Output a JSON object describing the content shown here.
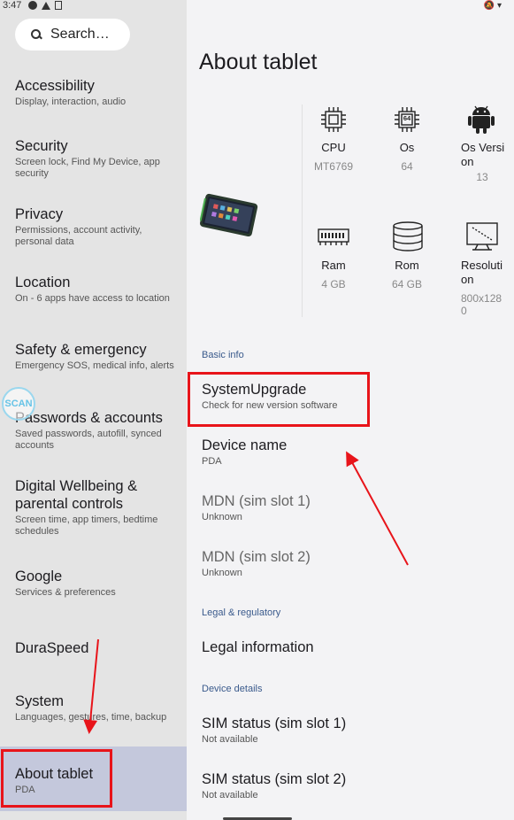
{
  "status_bar": {
    "time": "3:47"
  },
  "left": {
    "search_placeholder": "Search…",
    "items": [
      {
        "title": "Accessibility",
        "subtitle": "Display, interaction, audio"
      },
      {
        "title": "Security",
        "subtitle": "Screen lock, Find My Device, app security"
      },
      {
        "title": "Privacy",
        "subtitle": "Permissions, account activity, personal data"
      },
      {
        "title": "Location",
        "subtitle": "On - 6 apps have access to location"
      },
      {
        "title": "Safety & emergency",
        "subtitle": "Emergency SOS, medical info, alerts"
      },
      {
        "title": "Passwords & accounts",
        "subtitle": "Saved passwords, autofill, synced accounts"
      },
      {
        "title": "Digital Wellbeing & parental controls",
        "subtitle": "Screen time, app timers, bedtime schedules"
      },
      {
        "title": "Google",
        "subtitle": "Services & preferences"
      },
      {
        "title": "DuraSpeed",
        "subtitle": ""
      },
      {
        "title": "System",
        "subtitle": "Languages, gestures, time, backup"
      },
      {
        "title": "About tablet",
        "subtitle": "PDA"
      }
    ],
    "scan_label": "SCAN"
  },
  "main": {
    "title": "About tablet",
    "specs": [
      {
        "label": "CPU",
        "value": "MT6769",
        "icon": "cpu-icon"
      },
      {
        "label": "Os",
        "value": "64",
        "icon": "os-chip-icon"
      },
      {
        "label": "Os Version",
        "value": "13",
        "icon": "android-icon"
      },
      {
        "label": "Ram",
        "value": "4 GB",
        "icon": "ram-icon"
      },
      {
        "label": "Rom",
        "value": "64 GB",
        "icon": "storage-icon"
      },
      {
        "label": "Resolution",
        "value": "800x1280",
        "icon": "resolution-icon"
      }
    ],
    "os_chip_text": "64",
    "sections": {
      "basic_info": "Basic info",
      "legal": "Legal & regulatory",
      "device_details": "Device details"
    },
    "rows": {
      "system_upgrade": {
        "title": "SystemUpgrade",
        "subtitle": "Check for new version software"
      },
      "device_name": {
        "title": "Device name",
        "subtitle": "PDA"
      },
      "mdn1": {
        "title": "MDN (sim slot 1)",
        "subtitle": "Unknown"
      },
      "mdn2": {
        "title": "MDN (sim slot 2)",
        "subtitle": "Unknown"
      },
      "legal_info": {
        "title": "Legal information"
      },
      "sim1": {
        "title": "SIM status (sim slot 1)",
        "subtitle": "Not available"
      },
      "sim2": {
        "title": "SIM status (sim slot 2)",
        "subtitle": "Not available"
      }
    }
  },
  "colors": {
    "highlight": "#e8141a",
    "selected_bg": "#c4c8dc",
    "section": "#3a5a8c"
  }
}
